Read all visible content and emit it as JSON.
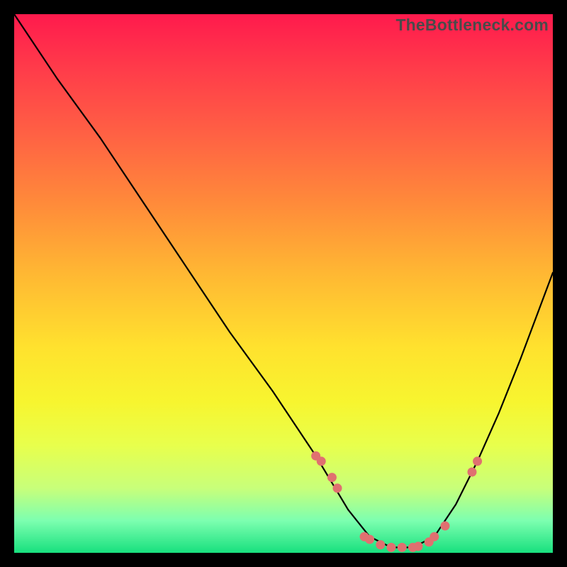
{
  "watermark": "TheBottleneck.com",
  "chart_data": {
    "type": "line",
    "title": "",
    "xlabel": "",
    "ylabel": "",
    "xlim": [
      0,
      100
    ],
    "ylim": [
      0,
      100
    ],
    "series": [
      {
        "name": "bottleneck-curve",
        "x": [
          0,
          8,
          16,
          24,
          32,
          40,
          48,
          56,
          62,
          66,
          70,
          74,
          78,
          82,
          86,
          90,
          94,
          100
        ],
        "y": [
          100,
          88,
          77,
          65,
          53,
          41,
          30,
          18,
          8,
          3,
          1,
          1,
          3,
          9,
          17,
          26,
          36,
          52
        ]
      }
    ],
    "markers": {
      "name": "highlighted-points",
      "x": [
        56,
        57,
        59,
        60,
        65,
        66,
        68,
        70,
        72,
        74,
        75,
        77,
        78,
        80,
        85,
        86
      ],
      "y": [
        18,
        17,
        14,
        12,
        3,
        2.5,
        1.5,
        1,
        1,
        1,
        1.2,
        2,
        3,
        5,
        15,
        17
      ]
    }
  }
}
